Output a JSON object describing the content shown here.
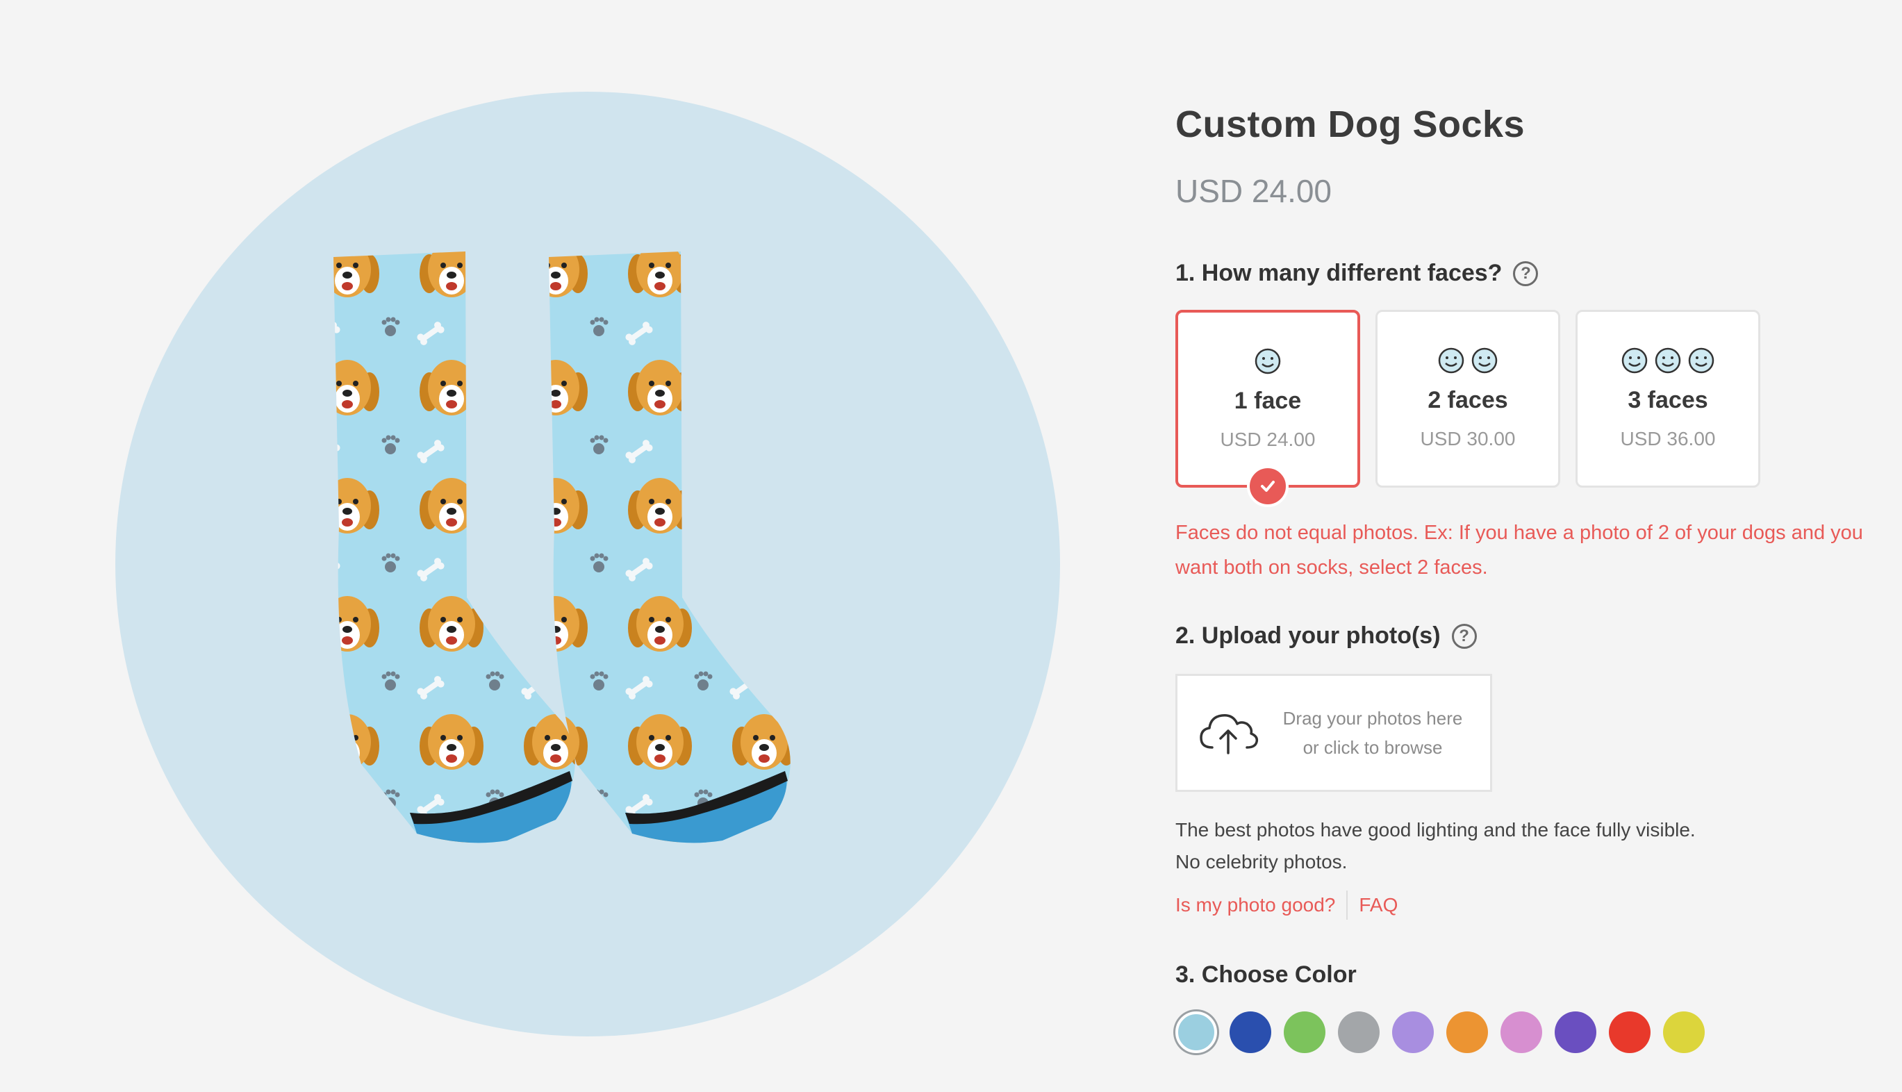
{
  "product": {
    "title": "Custom Dog Socks",
    "price": "USD 24.00"
  },
  "step1": {
    "label": "1. How many different faces?",
    "help": "?",
    "options": [
      {
        "label": "1 face",
        "price": "USD 24.00",
        "faces": 1,
        "selected": true
      },
      {
        "label": "2 faces",
        "price": "USD 30.00",
        "faces": 2,
        "selected": false
      },
      {
        "label": "3 faces",
        "price": "USD 36.00",
        "faces": 3,
        "selected": false
      }
    ],
    "note": "Faces do not equal photos. Ex: If you have a photo of 2 of your dogs and you want both on socks, select 2 faces."
  },
  "step2": {
    "label": "2. Upload your photo(s)",
    "help": "?",
    "upload_line1": "Drag your photos here",
    "upload_line2": "or click to browse",
    "tip_line1": "The best photos have good lighting and the face fully visible.",
    "tip_line2": "No celebrity photos.",
    "link_photo_good": "Is my photo good?",
    "link_faq": "FAQ"
  },
  "step3": {
    "label": "3. Choose Color",
    "colors": [
      "#9bcfe0",
      "#2a4fae",
      "#7cc35c",
      "#a3a6a9",
      "#a88ee0",
      "#ec9432",
      "#d78fd0",
      "#6a4fc0",
      "#e8392b",
      "#dcd53c"
    ],
    "selected_index": 0
  },
  "accent_color": "#e85a57"
}
